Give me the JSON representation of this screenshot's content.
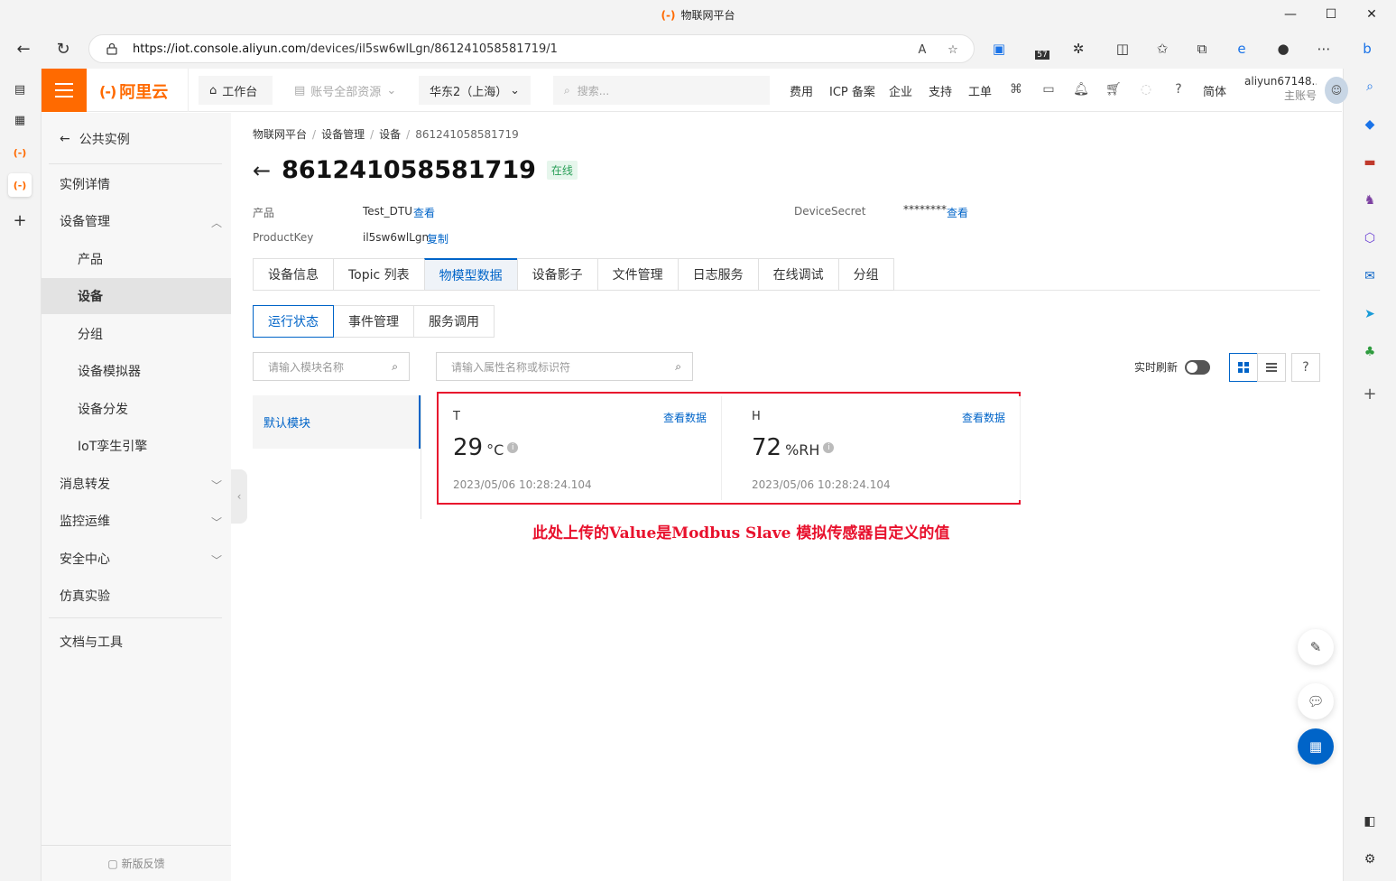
{
  "browser": {
    "window_title": "物联网平台",
    "url_host": "https://iot.console.aliyun.com",
    "url_path": "/devices/il5sw6wlLgn/861241058581719/1",
    "read_aloud_icon": "A",
    "edge_badge_count": "57"
  },
  "topnav": {
    "brand": "阿里云",
    "brand_mark": "(-)",
    "workbench": "工作台",
    "resource_scope": "账号全部资源",
    "region": "华东2（上海）",
    "search_placeholder": "搜索...",
    "links": [
      "费用",
      "ICP 备案",
      "企业",
      "支持",
      "工单"
    ],
    "language": "简体",
    "account_name": "aliyun67148...",
    "account_role": "主账号"
  },
  "sidebar": {
    "back_label": "公共实例",
    "items": [
      {
        "label": "实例详情"
      },
      {
        "label": "设备管理"
      },
      {
        "label": "产品"
      },
      {
        "label": "设备"
      },
      {
        "label": "分组"
      },
      {
        "label": "设备模拟器"
      },
      {
        "label": "设备分发"
      },
      {
        "label": "IoT孪生引擎"
      },
      {
        "label": "消息转发"
      },
      {
        "label": "监控运维"
      },
      {
        "label": "安全中心"
      },
      {
        "label": "仿真实验"
      },
      {
        "label": "文档与工具"
      }
    ],
    "feedback": "新版反馈"
  },
  "breadcrumb": [
    "物联网平台",
    "设备管理",
    "设备",
    "861241058581719"
  ],
  "device": {
    "id": "861241058581719",
    "status": "在线",
    "product_label": "产品",
    "product_value": "Test_DTU",
    "product_link": "查看",
    "productkey_label": "ProductKey",
    "productkey_value": "il5sw6wlLgn",
    "productkey_link": "复制",
    "secret_label": "DeviceSecret",
    "secret_value": "********",
    "secret_link": "查看"
  },
  "tabs": [
    "设备信息",
    "Topic 列表",
    "物模型数据",
    "设备影子",
    "文件管理",
    "日志服务",
    "在线调试",
    "分组"
  ],
  "subtabs": [
    "运行状态",
    "事件管理",
    "服务调用"
  ],
  "module_search_placeholder": "请输入模块名称",
  "property_search_placeholder": "请输入属性名称或标识符",
  "default_module": "默认模块",
  "realtime_refresh_label": "实时刷新",
  "realtime_refresh_on": false,
  "properties": [
    {
      "name": "T",
      "value": "29",
      "unit": "°C",
      "time": "2023/05/06 10:28:24.104",
      "link": "查看数据"
    },
    {
      "name": "H",
      "value": "72",
      "unit": "%RH",
      "time": "2023/05/06 10:28:24.104",
      "link": "查看数据"
    }
  ],
  "annotation": "此处上传的Value是Modbus Slave 模拟传感器自定义的值",
  "colors": {
    "brand_orange": "#ff6a00",
    "accent_blue": "#0064c8",
    "online_green": "#2ca05a",
    "annotation_red": "#e8112d"
  }
}
